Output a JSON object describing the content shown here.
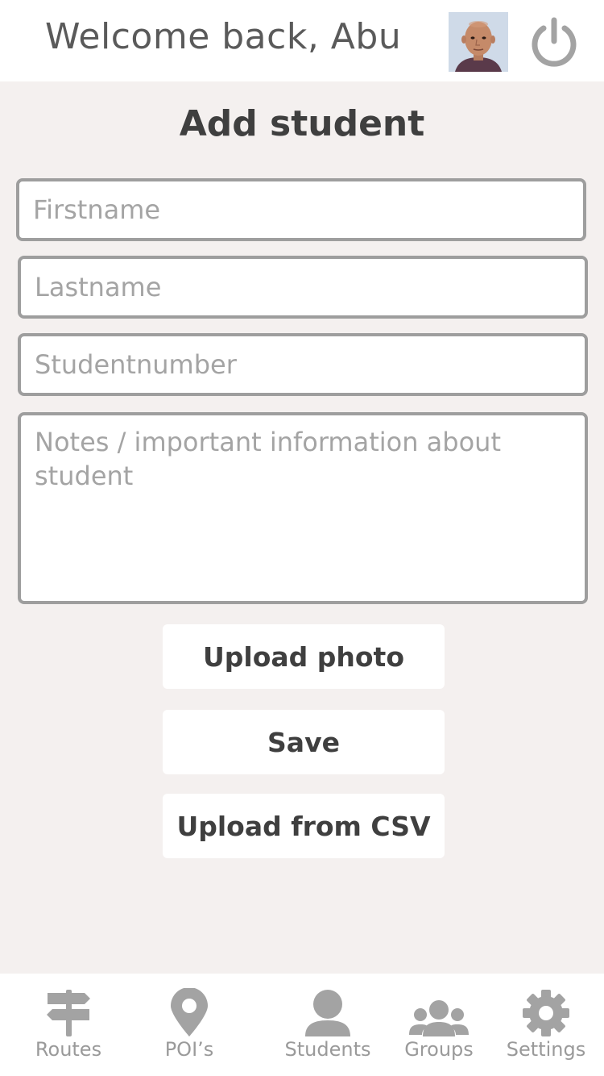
{
  "header": {
    "welcome_text": "Welcome back, Abu"
  },
  "page": {
    "title": "Add student"
  },
  "form": {
    "firstname_placeholder": "Firstname",
    "lastname_placeholder": "Lastname",
    "studentnumber_placeholder": "Studentnumber",
    "notes_placeholder": "Notes / important information about student"
  },
  "actions": {
    "upload_photo_label": "Upload photo",
    "save_label": "Save",
    "upload_csv_label": "Upload from CSV"
  },
  "nav": {
    "items": [
      {
        "label": "Routes",
        "icon": "signpost-icon"
      },
      {
        "label": "POI’s",
        "icon": "map-pin-icon"
      },
      {
        "label": "Students",
        "icon": "person-icon"
      },
      {
        "label": "Groups",
        "icon": "group-icon"
      },
      {
        "label": "Settings",
        "icon": "gear-icon"
      }
    ]
  },
  "colors": {
    "background": "#f4f0ef",
    "surface": "#ffffff",
    "border": "#9e9e9e",
    "icon": "#a3a3a3",
    "text_dark": "#3f3f3f"
  }
}
